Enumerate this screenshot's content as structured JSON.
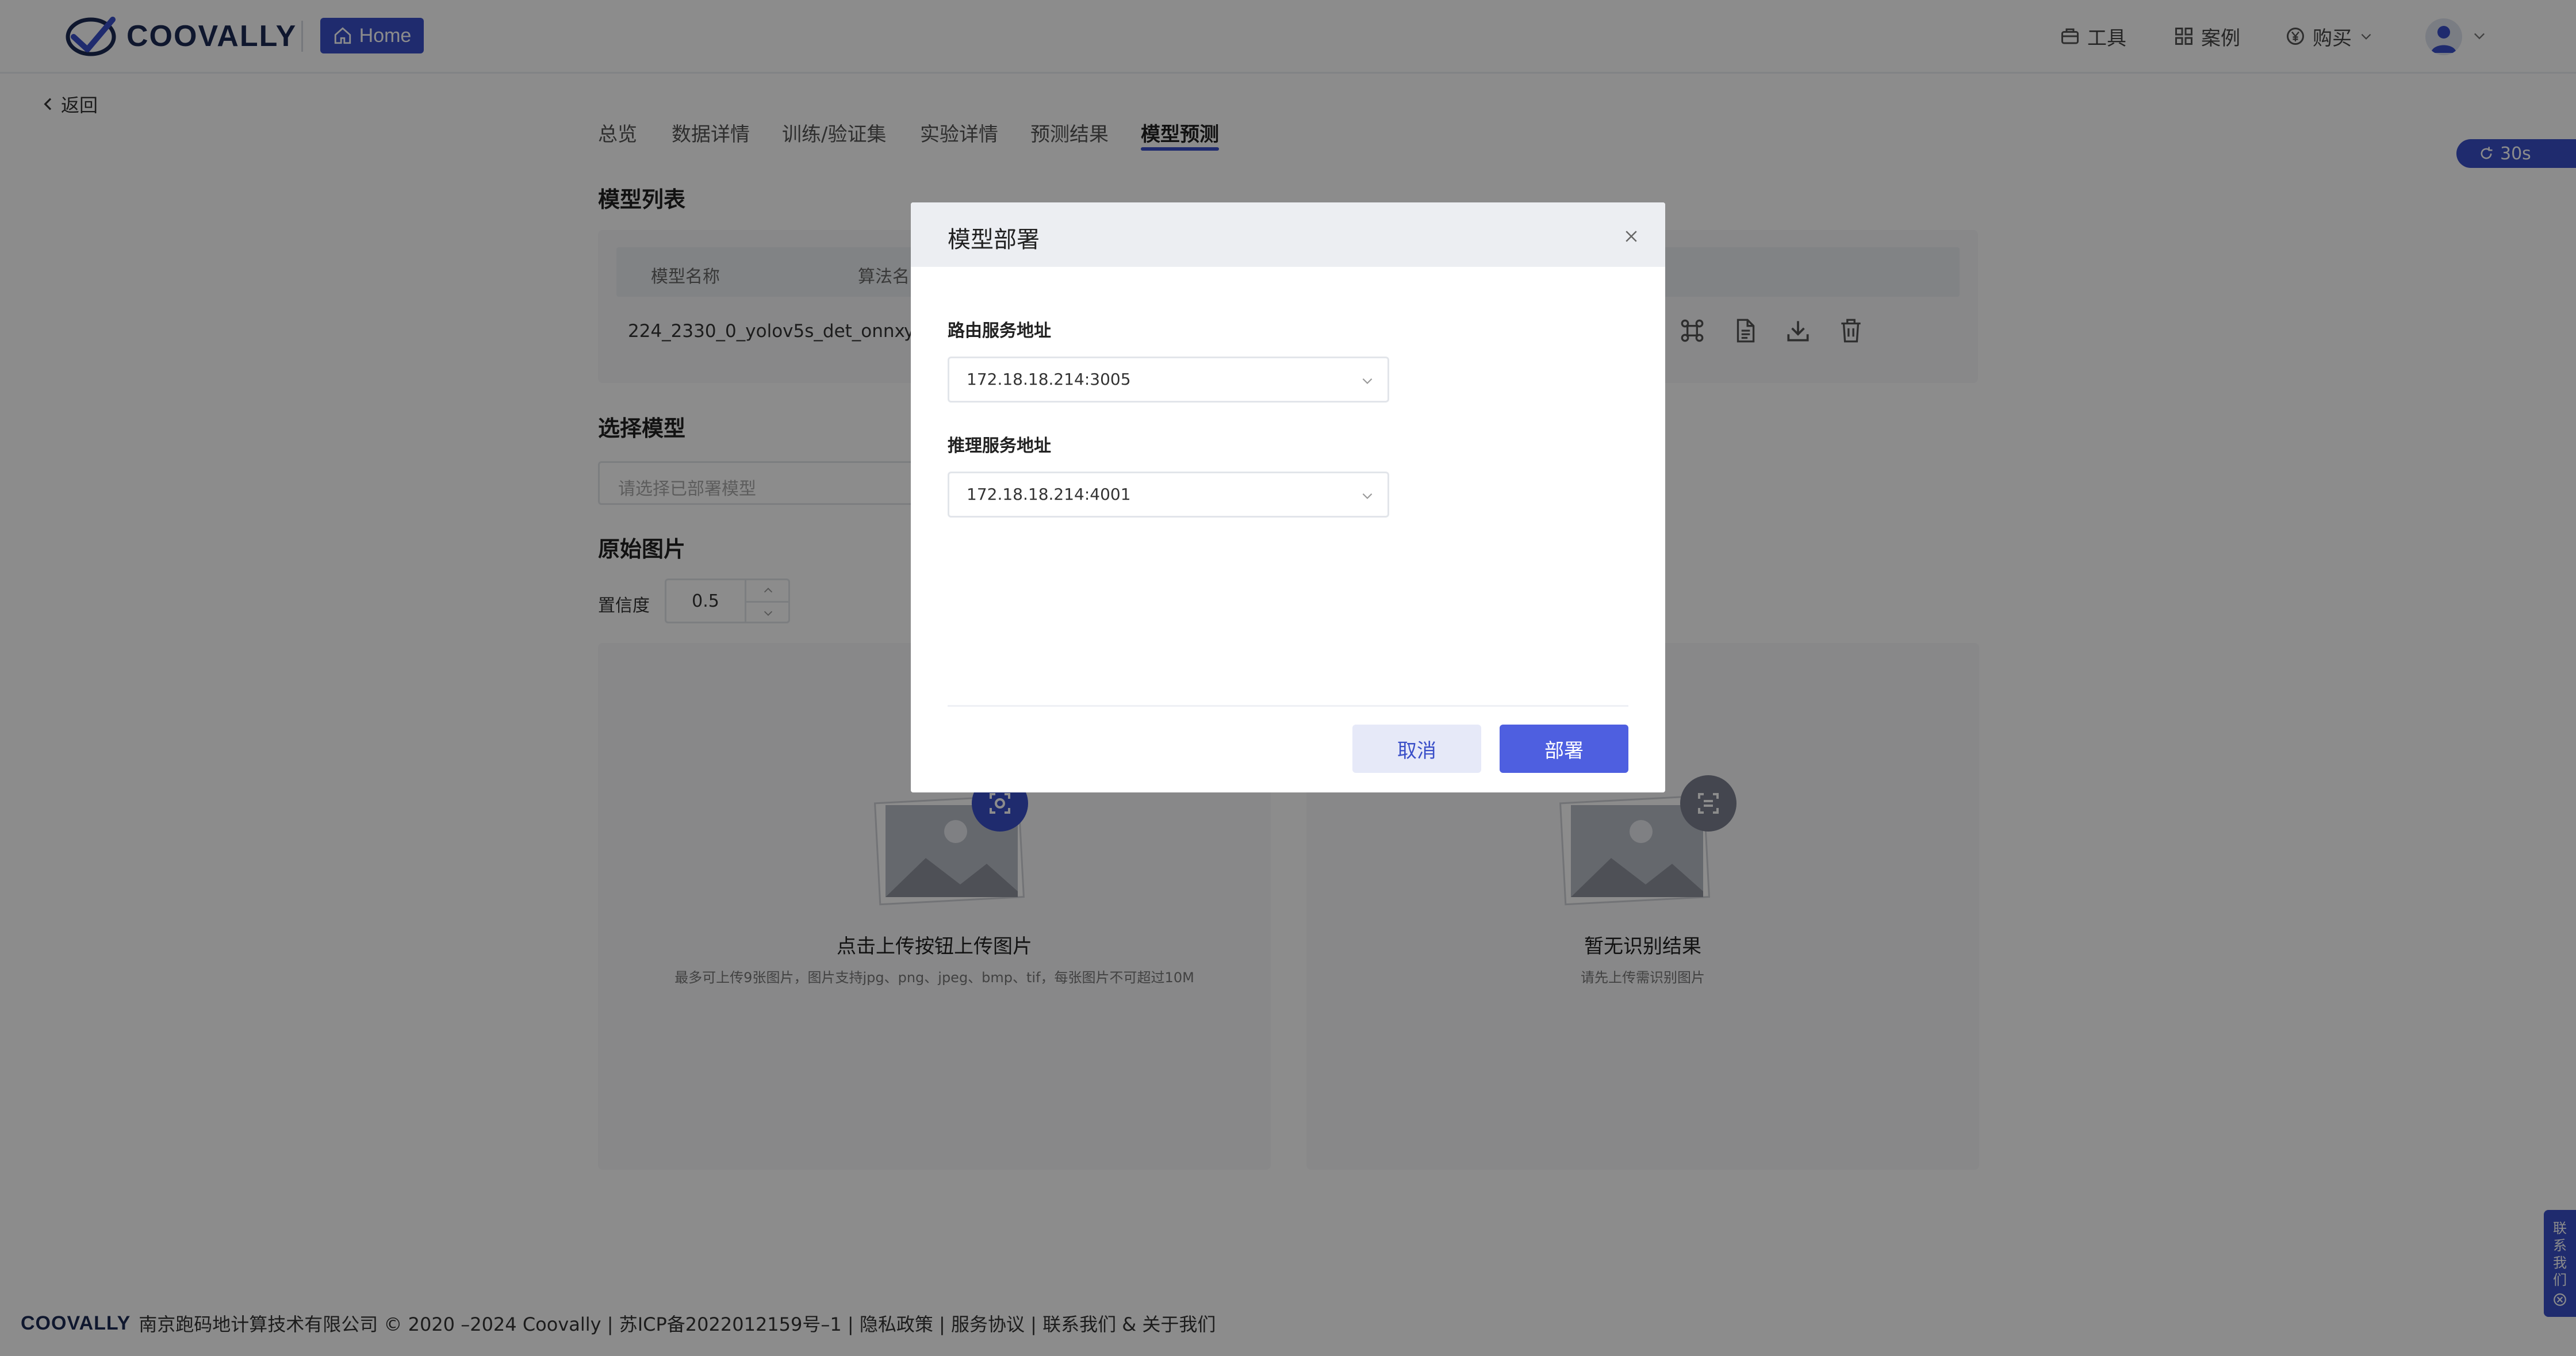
{
  "header": {
    "logo_text": "COOVALLY",
    "home_label": "Home",
    "nav": [
      {
        "label": "工具",
        "icon": "toolbox-icon"
      },
      {
        "label": "案例",
        "icon": "grid-icon"
      },
      {
        "label": "购买",
        "icon": "yen-icon"
      }
    ]
  },
  "back_label": "返回",
  "tabs": [
    "总览",
    "数据详情",
    "训练/验证集",
    "实验详情",
    "预测结果",
    "模型预测"
  ],
  "active_tab": "模型预测",
  "timer_label": "30s",
  "model_list": {
    "title": "模型列表",
    "columns": [
      "模型名称",
      "算法名"
    ],
    "row": {
      "name": "224_2330_0_yolov5s_det_onnx",
      "algo_partial": "y"
    }
  },
  "select_model": {
    "title": "选择模型",
    "placeholder": "请选择已部署模型"
  },
  "original_image": {
    "title": "原始图片",
    "confidence_label": "置信度",
    "confidence_value": "0.5"
  },
  "upload_panel": {
    "title": "点击上传按钮上传图片",
    "subtitle": "最多可上传9张图片，图片支持jpg、png、jpeg、bmp、tif，每张图片不可超过10M"
  },
  "result_panel": {
    "title": "暂无识别结果",
    "subtitle": "请先上传需识别图片"
  },
  "contact_label": [
    "联",
    "系",
    "我",
    "们"
  ],
  "footer": {
    "logo": "COOVALLY",
    "text": "南京跑码地计算技术有限公司 © 2020 –2024 Coovally | 苏ICP备2022012159号–1 | 隐私政策 | 服务协议 | 联系我们 & 关于我们"
  },
  "modal": {
    "title": "模型部署",
    "route_label": "路由服务地址",
    "route_value": "172.18.18.214:3005",
    "infer_label": "推理服务地址",
    "infer_value": "172.18.18.214:4001",
    "cancel_label": "取消",
    "deploy_label": "部署"
  },
  "colors": {
    "accent": "#3a4fc8",
    "deploy_button": "#4e5fe0",
    "overlay": "rgba(0,0,0,0.45)"
  }
}
